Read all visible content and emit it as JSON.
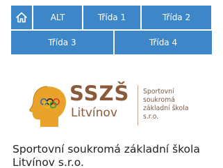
{
  "nav": {
    "home_icon": "home-icon",
    "items": [
      {
        "label": "ALT"
      },
      {
        "label": "Třída 1"
      },
      {
        "label": "Třída 2"
      },
      {
        "label": "Třída 3"
      },
      {
        "label": "Třída 4"
      }
    ]
  },
  "logo": {
    "abbr": "SSZŠ",
    "town": "Litvínov",
    "subtitle_lines": [
      "Sportovní",
      "soukromá",
      "základní škola",
      "s.r.o."
    ]
  },
  "school_name": "Sportovní soukromá základní škola Litvínov s.r.o.",
  "colors": {
    "nav_blue": "#3d87c8",
    "brand_brown": "#8a5a3b",
    "emblem_gold": "#e9a22a"
  }
}
